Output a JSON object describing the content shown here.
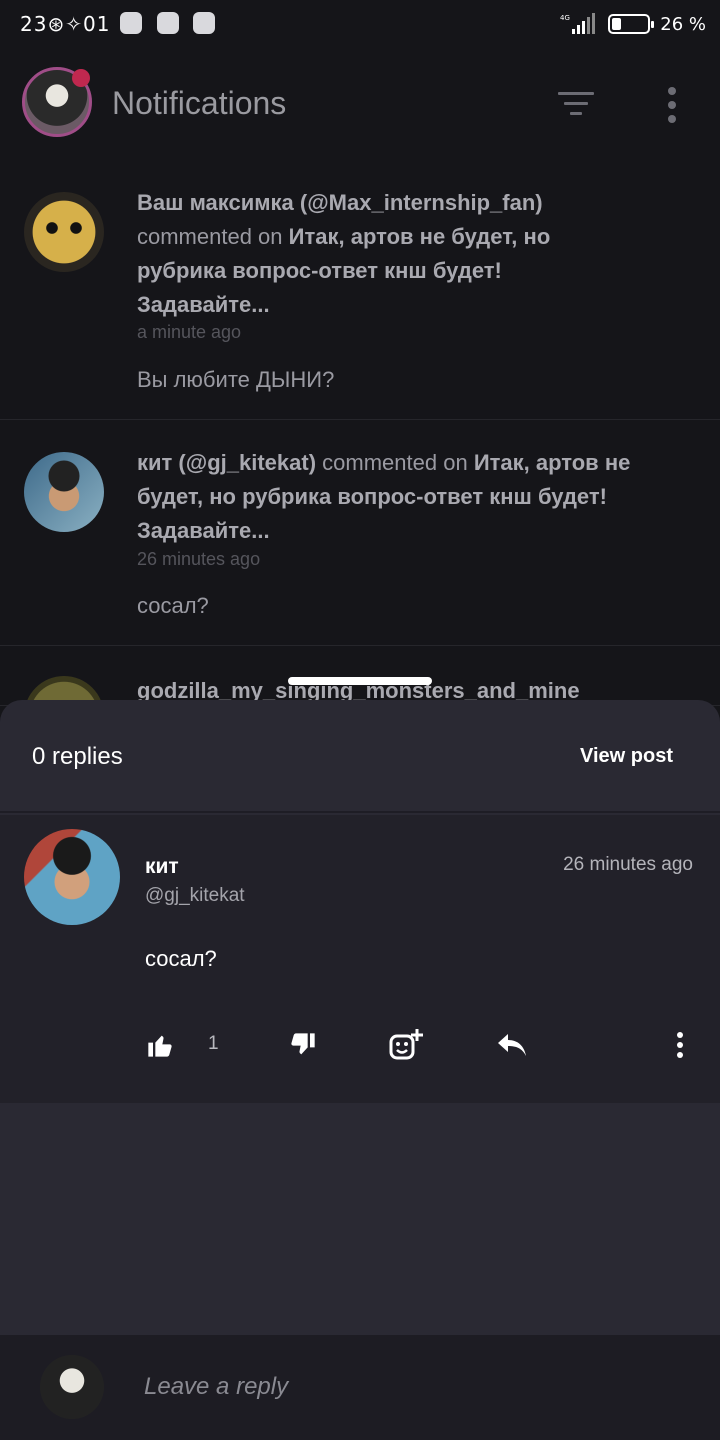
{
  "status_bar": {
    "time": "23",
    "battery_percent": "26",
    "battery_level": 0.26,
    "network": "4G"
  },
  "header": {
    "title": "Notifications",
    "filter_icon": "filter-icon",
    "more_icon": "more-vert-icon",
    "notification_dot_color": "#c0284f"
  },
  "notifications": [
    {
      "author": "Ваш максимка (@Max_internship_fan)",
      "action": "commented on",
      "post": "Итак, артов не будет, но рубрика вопрос-ответ кнш будет! Задавайте...",
      "time": "a minute ago",
      "comment": "Вы любите ДЫНИ?"
    },
    {
      "author": "кит (@gj_kitekat)",
      "action": "commented on",
      "post": "Итак, артов не будет, но рубрика вопрос-ответ кнш будет! Задавайте...",
      "time": "26 minutes ago",
      "comment": "сосал?"
    },
    {
      "author": "godzilla_my_singing_monsters_and_mine"
    }
  ],
  "sheet": {
    "replies_label": "0 replies",
    "view_post_label": "View post",
    "comment": {
      "name": "кит",
      "handle": "@gj_kitekat",
      "time": "26 minutes ago",
      "body": "сосал?",
      "likes": "1"
    },
    "reply": {
      "placeholder": "Leave a reply"
    }
  }
}
